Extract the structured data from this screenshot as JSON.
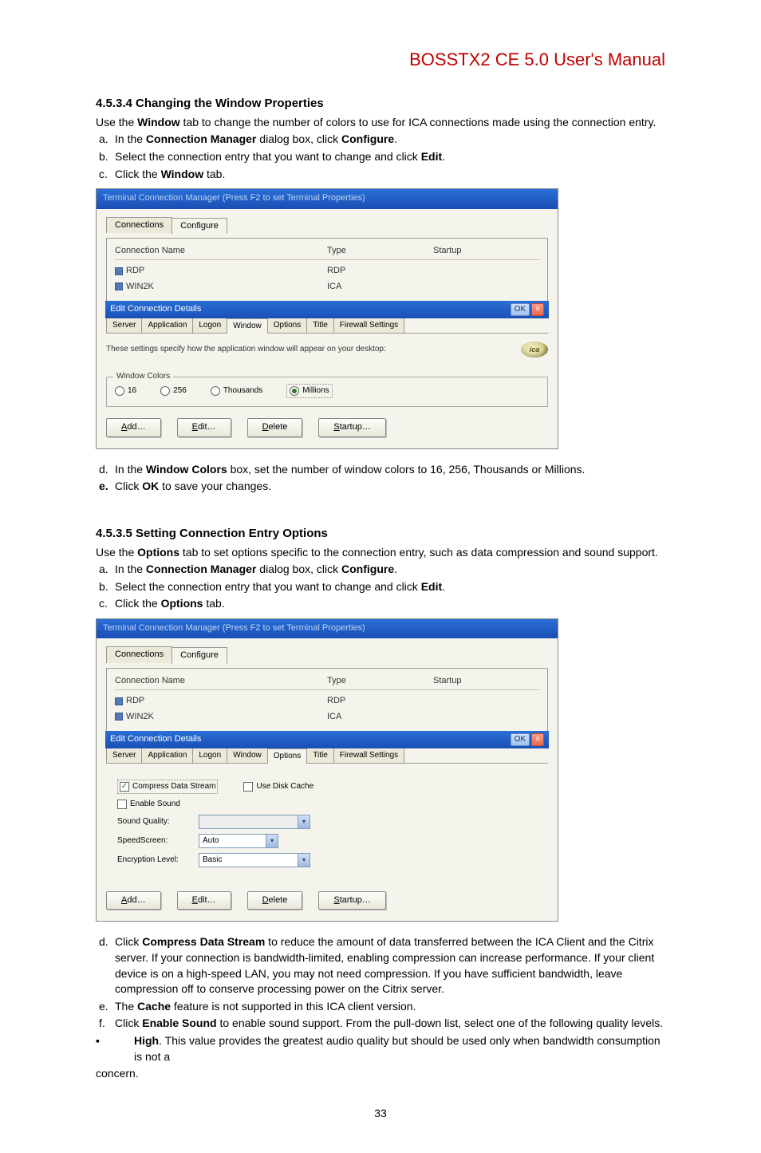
{
  "doc_title": "BOSSTX2 CE 5.0 User's Manual",
  "page_number": "33",
  "section1": {
    "heading": "4.5.3.4  Changing the Window Properties",
    "intro": "Use the Window tab to change the number of colors to use for ICA connections made using the connection entry.",
    "steps": {
      "a": {
        "text": "In the ",
        "b1": "Connection Manager",
        "mid": " dialog box, click ",
        "b2": "Configure",
        "end": "."
      },
      "b": {
        "text": "Select the connection entry that you want to change and click ",
        "b1": "Edit",
        "end": "."
      },
      "c": {
        "text": "Click the ",
        "b1": "Window",
        "end": " tab."
      },
      "d": {
        "text": "In the ",
        "b1": "Window Colors",
        "mid": " box, set the number of window colors to 16, 256, Thousands or Millions."
      },
      "e": {
        "text": "Click ",
        "b1": "OK",
        "end": " to save your changes."
      }
    }
  },
  "section2": {
    "heading": "4.5.3.5  Setting Connection Entry Options",
    "intro": "Use the Options tab to set options specific to the connection entry, such as data compression and sound support.",
    "steps": {
      "a": {
        "text": "In the ",
        "b1": "Connection Manager",
        "mid": " dialog box, click ",
        "b2": "Configure",
        "end": "."
      },
      "b": {
        "text": "Select the connection entry that you want to change and click ",
        "b1": "Edit",
        "end": "."
      },
      "c": {
        "text": "Click the ",
        "b1": "Options",
        "end": " tab."
      }
    },
    "post": {
      "d": {
        "text": "Click ",
        "b1": "Compress Data Stream",
        "rest": " to reduce the amount of data transferred between the ICA Client and the Citrix server. If your connection is bandwidth-limited, enabling compression can increase performance. If your client device is on a high-speed LAN, you may not need compression. If you have sufficient bandwidth, leave compression off to conserve processing power on the Citrix server."
      },
      "e": {
        "text": "The ",
        "b1": "Cache",
        "rest": " feature is not supported in this ICA client version."
      },
      "f": {
        "text": "Click ",
        "b1": "Enable Sound",
        "rest": " to enable sound support. From the pull-down list, select one of the following quality levels."
      },
      "bullet_high": {
        "b1": "High",
        "rest": ". This value provides the greatest audio quality but should be used only when bandwidth consumption is not a"
      },
      "concern": "concern."
    }
  },
  "figure_common": {
    "connmgr_title": "Terminal Connection Manager (Press F2 to set Terminal Properties)",
    "tabs": {
      "connections": "Connections",
      "configure": "Configure"
    },
    "col": {
      "name": "Connection Name",
      "type": "Type",
      "startup": "Startup"
    },
    "rows": [
      {
        "name": "RDP",
        "type": "RDP",
        "startup": ""
      },
      {
        "name": "WIN2K",
        "type": "ICA",
        "startup": ""
      }
    ],
    "edit_title": "Edit Connection Details",
    "ok": "OK",
    "x": "×",
    "detail_tabs": {
      "server": "Server",
      "application": "Application",
      "logon": "Logon",
      "window": "Window",
      "options": "Options",
      "title": "Title",
      "firewall": "Firewall Settings"
    },
    "window_note": "These settings specify how the application window will appear on your desktop:",
    "ica_logo": "ica",
    "window_colors_legend": "Window Colors",
    "radios": {
      "r16": "16",
      "r256": "256",
      "rthousands": "Thousands",
      "rmillions": "Millions"
    },
    "buttons": {
      "add": "Add…",
      "edit": "Edit…",
      "delete": "Delete",
      "startup": "Startup…"
    }
  },
  "figure2": {
    "compress": "Compress Data Stream",
    "disk_cache": "Use Disk Cache",
    "enable_sound": "Enable Sound",
    "sound_quality": "Sound Quality:",
    "speedscreen": "SpeedScreen:",
    "speedscreen_val": "Auto",
    "encryption": "Encryption Level:",
    "encryption_val": "Basic"
  }
}
